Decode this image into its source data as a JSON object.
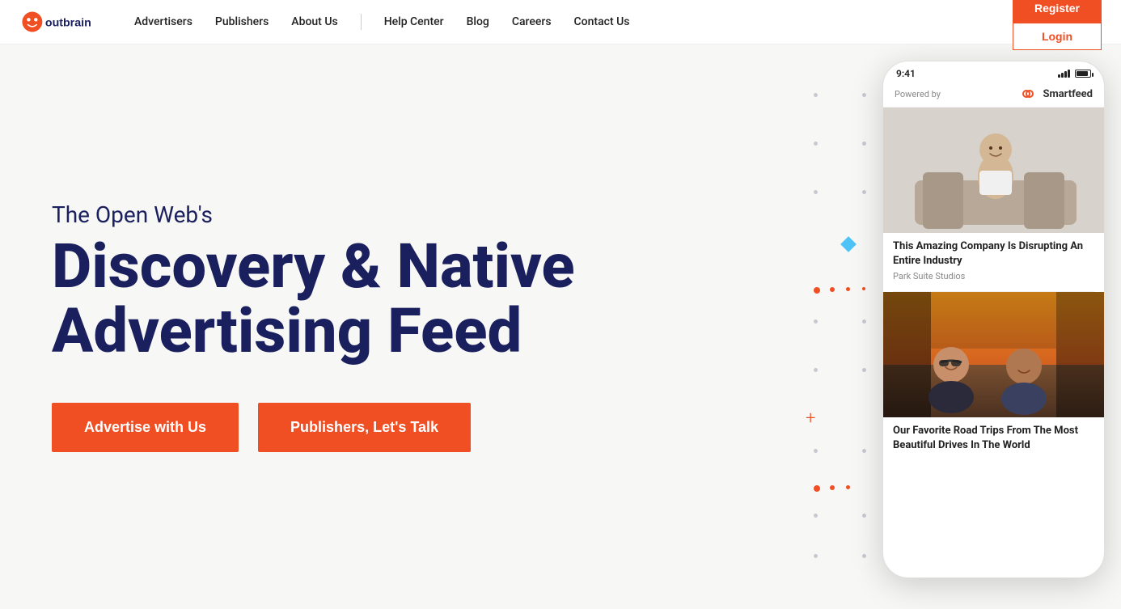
{
  "nav": {
    "logo_text": "outbrain",
    "links": [
      {
        "label": "Advertisers",
        "name": "nav-advertisers"
      },
      {
        "label": "Publishers",
        "name": "nav-publishers"
      },
      {
        "label": "About Us",
        "name": "nav-about"
      },
      {
        "label": "Help Center",
        "name": "nav-help"
      },
      {
        "label": "Blog",
        "name": "nav-blog"
      },
      {
        "label": "Careers",
        "name": "nav-careers"
      },
      {
        "label": "Contact Us",
        "name": "nav-contact"
      }
    ],
    "register_label": "Register",
    "login_label": "Login"
  },
  "hero": {
    "subtitle": "The Open Web's",
    "title_line1": "Discovery & Native",
    "title_line2": "Advertising Feed",
    "btn_advertise": "Advertise with Us",
    "btn_publishers": "Publishers, Let's Talk"
  },
  "phone": {
    "time": "9:41",
    "powered_by": "Powered by",
    "smartfeed": "Smartfeed",
    "card1": {
      "title": "This Amazing Company Is Disrupting An Entire Industry",
      "source": "Park Suite Studios"
    },
    "card2": {
      "title": "Our Favorite Road Trips From The Most Beautiful Drives In The World",
      "source": ""
    }
  },
  "colors": {
    "orange": "#f04e23",
    "navy": "#1a1f5e",
    "bg": "#f7f7f5"
  }
}
